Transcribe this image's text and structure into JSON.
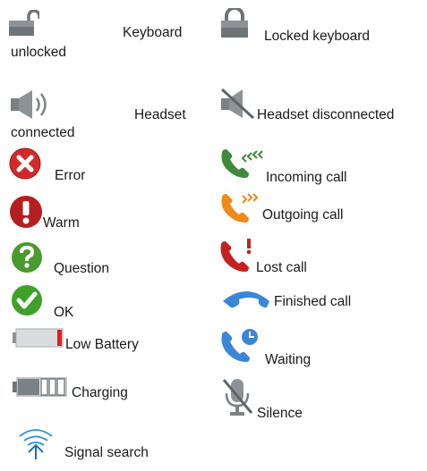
{
  "legend": {
    "keyboard_unlocked": {
      "icon": "open-padlock-icon",
      "label_right": "Keyboard",
      "label_below": "unlocked"
    },
    "keyboard_locked": {
      "icon": "closed-padlock-icon",
      "label": "Locked keyboard"
    },
    "headset_connected": {
      "icon": "speaker-icon",
      "label_right": "Headset",
      "label_below": "connected"
    },
    "headset_disconnected": {
      "icon": "speaker-muted-icon",
      "label": "Headset disconnected"
    },
    "error": {
      "icon": "error-icon",
      "label": "Error",
      "color": "#d22a2a"
    },
    "incoming_call": {
      "icon": "incoming-call-icon",
      "label": "Incoming call",
      "color": "#3f8a3a"
    },
    "warm": {
      "icon": "warning-icon",
      "label": "Warm",
      "color": "#b51f1f"
    },
    "outgoing_call": {
      "icon": "outgoing-call-icon",
      "label": "Outgoing call",
      "color": "#f08a1c"
    },
    "question": {
      "icon": "question-icon",
      "label": "Question",
      "color": "#4a9a2e"
    },
    "lost_call": {
      "icon": "lost-call-icon",
      "label": "Lost call",
      "color": "#c42222"
    },
    "ok": {
      "icon": "ok-check-icon",
      "label": "OK",
      "color": "#3fa02a"
    },
    "finished_call": {
      "icon": "finished-call-icon",
      "label": "Finished call",
      "color": "#3b86d6"
    },
    "low_battery": {
      "icon": "low-battery-icon",
      "label": "Low Battery"
    },
    "waiting": {
      "icon": "waiting-call-icon",
      "label": "Waiting",
      "color": "#3b86d6"
    },
    "charging": {
      "icon": "charging-battery-icon",
      "label": "Charging"
    },
    "silence": {
      "icon": "muted-microphone-icon",
      "label": "Silence"
    },
    "signal_search": {
      "icon": "antenna-signal-icon",
      "label": "Signal search",
      "color": "#2a8fd8"
    }
  }
}
